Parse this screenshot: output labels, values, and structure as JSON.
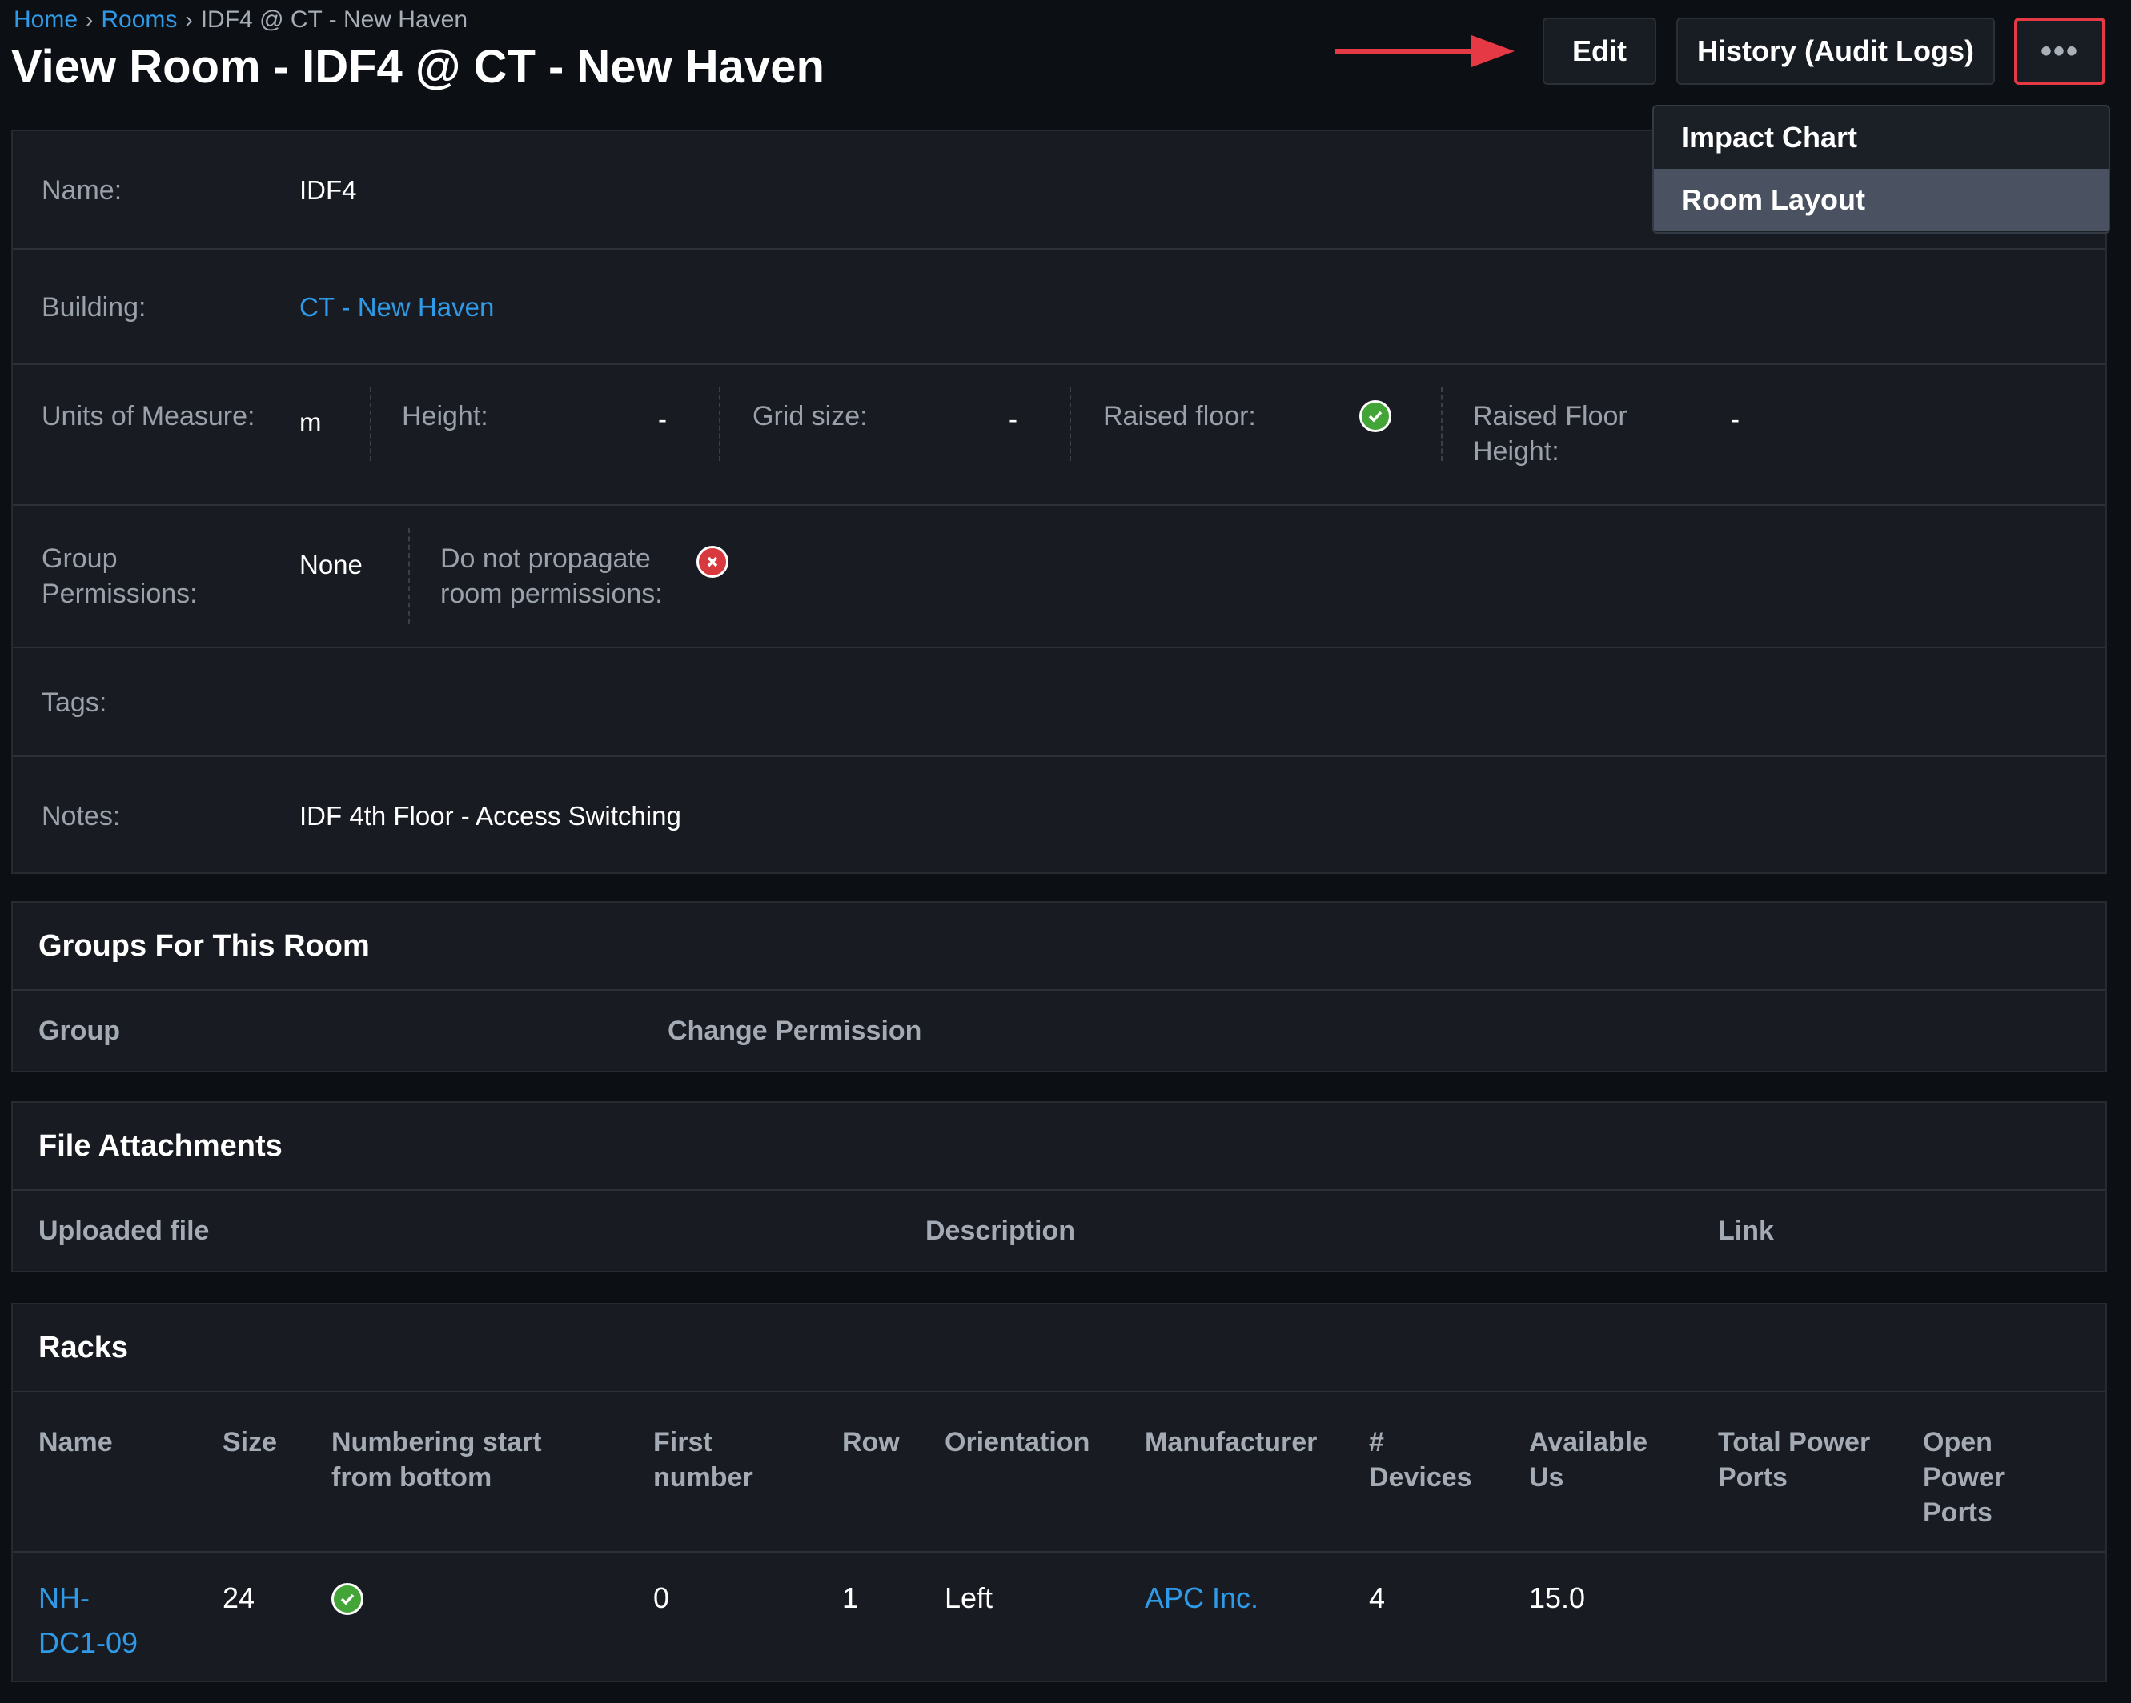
{
  "breadcrumb": {
    "home": "Home",
    "rooms": "Rooms",
    "current": "IDF4 @ CT - New Haven",
    "separator": "›"
  },
  "page_title": "View Room - IDF4 @ CT - New Haven",
  "toolbar": {
    "edit_label": "Edit",
    "history_label": "History (Audit Logs)",
    "more_label": "•••"
  },
  "dropdown": {
    "items": [
      {
        "label": "Impact Chart"
      },
      {
        "label": "Room Layout"
      }
    ],
    "active_index": 1
  },
  "room": {
    "name_label": "Name:",
    "name_value": "IDF4",
    "building_label": "Building:",
    "building_value": "CT - New Haven",
    "units_label": "Units of Measure:",
    "units_value": "m",
    "height_label": "Height:",
    "height_value": "-",
    "grid_label": "Grid size:",
    "grid_value": "-",
    "raised_label": "Raised floor:",
    "raised_value": true,
    "raised_height_label_1": "Raised Floor",
    "raised_height_label_2": "Height:",
    "raised_height_value": "-",
    "group_perm_label_1": "Group",
    "group_perm_label_2": "Permissions:",
    "group_perm_value": "None",
    "no_propagate_label_1": "Do not propagate",
    "no_propagate_label_2": "room permissions:",
    "no_propagate_value": false,
    "tags_label": "Tags:",
    "notes_label": "Notes:",
    "notes_value": "IDF 4th Floor - Access Switching"
  },
  "groups_panel": {
    "title": "Groups For This Room",
    "columns": [
      "Group",
      "Change Permission"
    ]
  },
  "files_panel": {
    "title": "File Attachments",
    "columns": [
      "Uploaded file",
      "Description",
      "Link"
    ]
  },
  "racks_panel": {
    "title": "Racks",
    "columns": {
      "name": [
        "Name"
      ],
      "size": [
        "Size"
      ],
      "numbering": [
        "Numbering start",
        "from bottom"
      ],
      "first": [
        "First",
        "number"
      ],
      "row": [
        "Row"
      ],
      "orientation": [
        "Orientation"
      ],
      "manufacturer": [
        "Manufacturer"
      ],
      "devices": [
        "#",
        "Devices"
      ],
      "available": [
        "Available",
        "Us"
      ],
      "total_power": [
        "Total Power",
        "Ports"
      ],
      "open_power": [
        "Open",
        "Power",
        "Ports"
      ]
    },
    "rows": [
      {
        "name_1": "NH-",
        "name_2": "DC1-09",
        "size": "24",
        "numbering_from_bottom": true,
        "first_number": "0",
        "row": "1",
        "orientation": "Left",
        "manufacturer": "APC Inc.",
        "devices": "4",
        "available_us": "15.0",
        "total_power_ports": "",
        "open_power_ports": ""
      }
    ]
  },
  "colors": {
    "link": "#2f9be8",
    "highlight_border": "#e53a45",
    "arrow": "#e53a45",
    "ok": "#43a437",
    "error": "#d8393f"
  }
}
